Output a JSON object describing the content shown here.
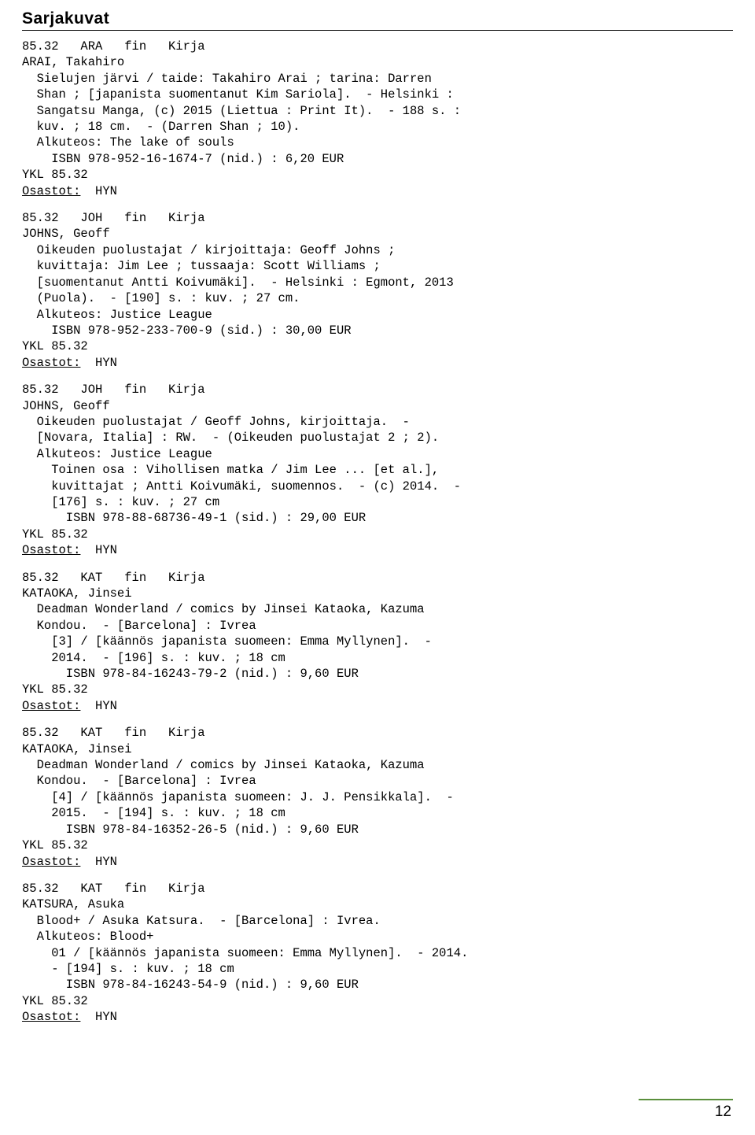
{
  "document": {
    "title": "Sarjakuvat",
    "page_number": "12",
    "footer_rule_color": "#5a8f3c"
  },
  "records": [
    {
      "class_line": "85.32   ARA   fin   Kirja",
      "lines": [
        "ARAI, Takahiro",
        "  Sielujen järvi / taide: Takahiro Arai ; tarina: Darren",
        "  Shan ; [japanista suomentanut Kim Sariola].  - Helsinki :",
        "  Sangatsu Manga, (c) 2015 (Liettua : Print It).  - 188 s. :",
        "  kuv. ; 18 cm.  - (Darren Shan ; 10).",
        "  Alkuteos: The lake of souls",
        "    ISBN 978-952-16-1674-7 (nid.) : 6,20 EUR",
        "YKL 85.32"
      ],
      "osastot_label": "Osastot:",
      "osastot_value": "HYN"
    },
    {
      "class_line": "85.32   JOH   fin   Kirja",
      "lines": [
        "JOHNS, Geoff",
        "  Oikeuden puolustajat / kirjoittaja: Geoff Johns ;",
        "  kuvittaja: Jim Lee ; tussaaja: Scott Williams ;",
        "  [suomentanut Antti Koivumäki].  - Helsinki : Egmont, 2013",
        "  (Puola).  - [190] s. : kuv. ; 27 cm.",
        "  Alkuteos: Justice League",
        "    ISBN 978-952-233-700-9 (sid.) : 30,00 EUR",
        "YKL 85.32"
      ],
      "osastot_label": "Osastot:",
      "osastot_value": "HYN"
    },
    {
      "class_line": "85.32   JOH   fin   Kirja",
      "lines": [
        "JOHNS, Geoff",
        "  Oikeuden puolustajat / Geoff Johns, kirjoittaja.  -",
        "  [Novara, Italia] : RW.  - (Oikeuden puolustajat 2 ; 2).",
        "  Alkuteos: Justice League",
        "    Toinen osa : Vihollisen matka / Jim Lee ... [et al.],",
        "    kuvittajat ; Antti Koivumäki, suomennos.  - (c) 2014.  -",
        "    [176] s. : kuv. ; 27 cm",
        "      ISBN 978-88-68736-49-1 (sid.) : 29,00 EUR",
        "YKL 85.32"
      ],
      "osastot_label": "Osastot:",
      "osastot_value": "HYN"
    },
    {
      "class_line": "85.32   KAT   fin   Kirja",
      "lines": [
        "KATAOKA, Jinsei",
        "  Deadman Wonderland / comics by Jinsei Kataoka, Kazuma",
        "  Kondou.  - [Barcelona] : Ivrea",
        "    [3] / [käännös japanista suomeen: Emma Myllynen].  -",
        "    2014.  - [196] s. : kuv. ; 18 cm",
        "      ISBN 978-84-16243-79-2 (nid.) : 9,60 EUR",
        "YKL 85.32"
      ],
      "osastot_label": "Osastot:",
      "osastot_value": "HYN"
    },
    {
      "class_line": "85.32   KAT   fin   Kirja",
      "lines": [
        "KATAOKA, Jinsei",
        "  Deadman Wonderland / comics by Jinsei Kataoka, Kazuma",
        "  Kondou.  - [Barcelona] : Ivrea",
        "    [4] / [käännös japanista suomeen: J. J. Pensikkala].  -",
        "    2015.  - [194] s. : kuv. ; 18 cm",
        "      ISBN 978-84-16352-26-5 (nid.) : 9,60 EUR",
        "YKL 85.32"
      ],
      "osastot_label": "Osastot:",
      "osastot_value": "HYN"
    },
    {
      "class_line": "85.32   KAT   fin   Kirja",
      "lines": [
        "KATSURA, Asuka",
        "  Blood+ / Asuka Katsura.  - [Barcelona] : Ivrea.",
        "  Alkuteos: Blood+",
        "    01 / [käännös japanista suomeen: Emma Myllynen].  - 2014.",
        "    - [194] s. : kuv. ; 18 cm",
        "      ISBN 978-84-16243-54-9 (nid.) : 9,60 EUR",
        "YKL 85.32"
      ],
      "osastot_label": "Osastot:",
      "osastot_value": "HYN"
    }
  ]
}
